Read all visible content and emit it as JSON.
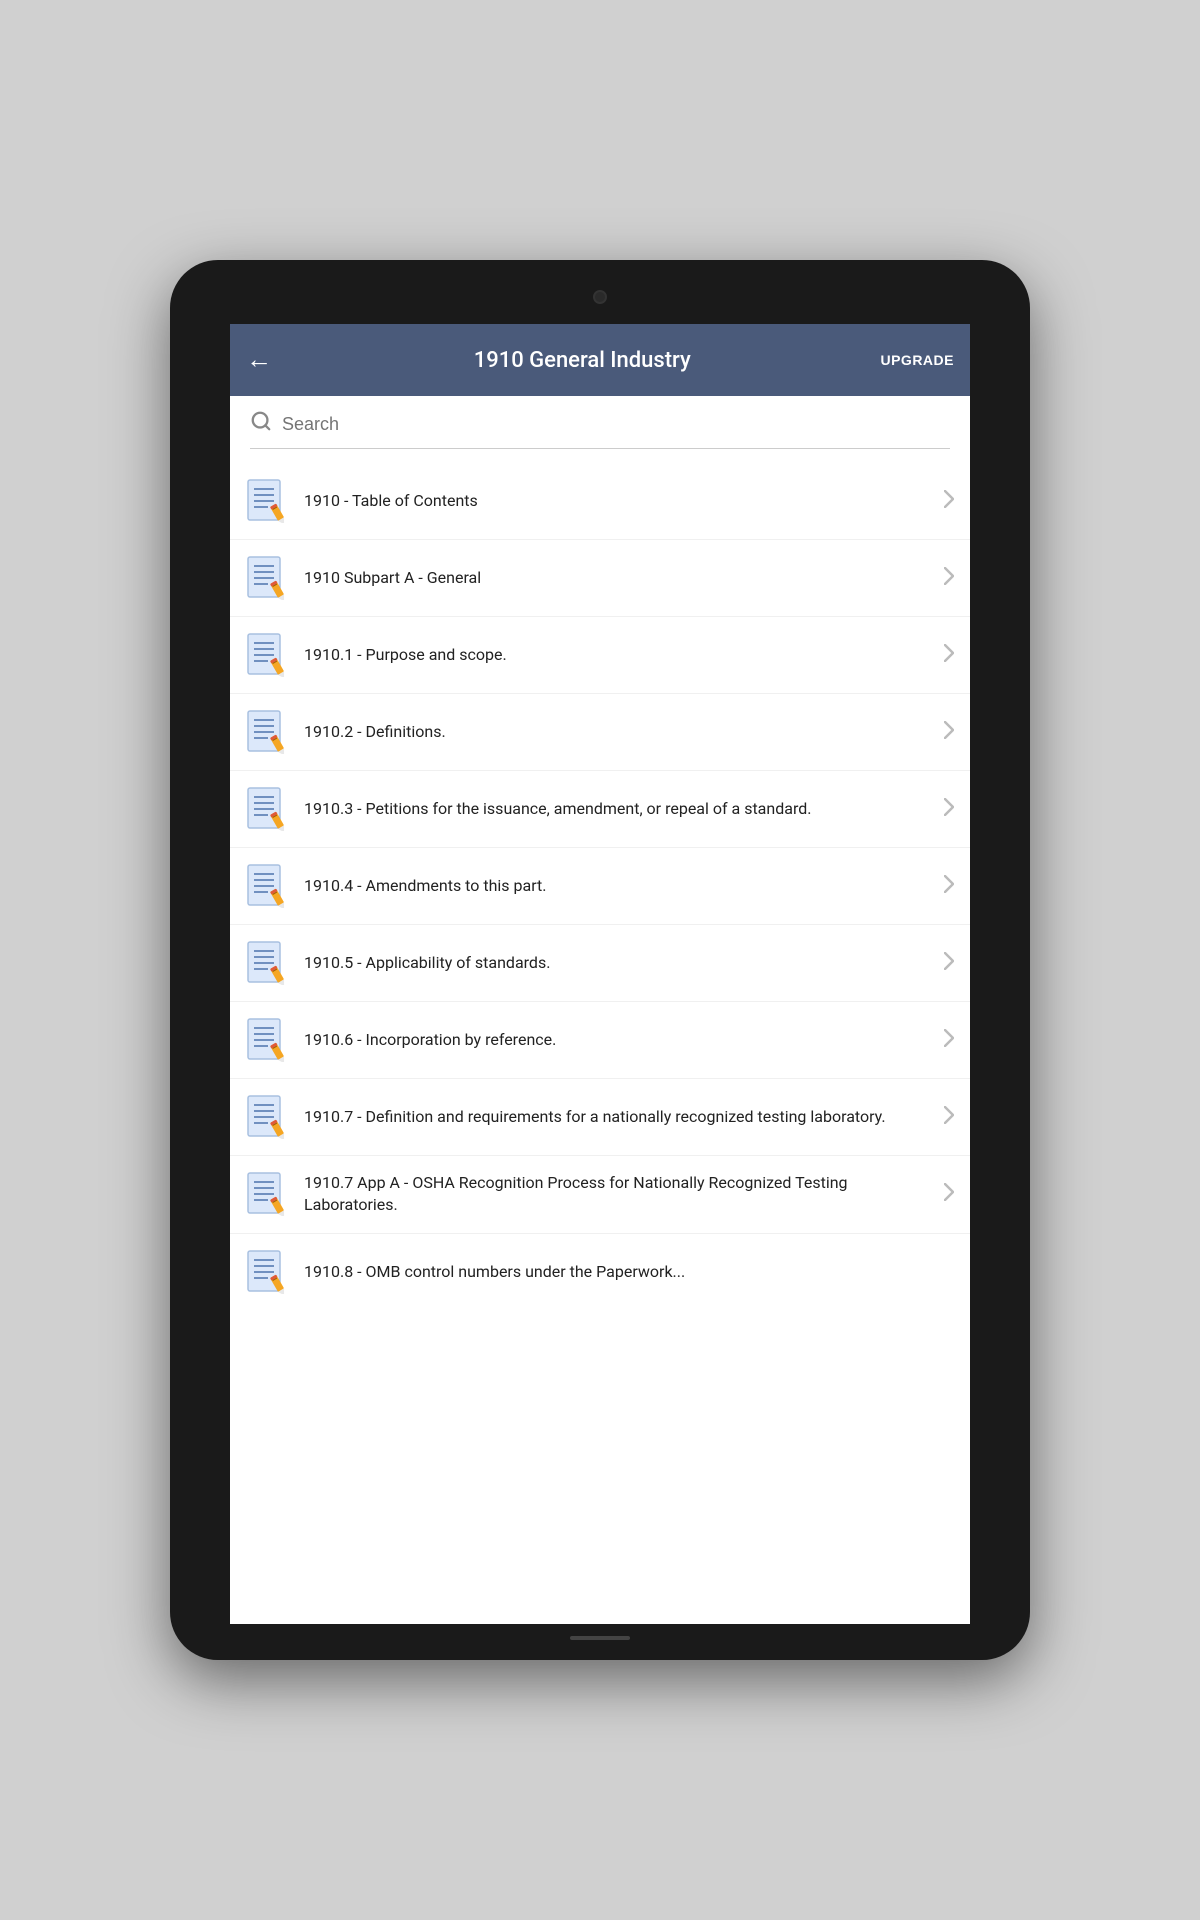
{
  "header": {
    "title": "1910 General Industry",
    "back_label": "←",
    "upgrade_label": "UPGRADE"
  },
  "search": {
    "placeholder": "Search"
  },
  "items": [
    {
      "id": 1,
      "label": "1910 - Table of Contents"
    },
    {
      "id": 2,
      "label": "1910 Subpart A - General"
    },
    {
      "id": 3,
      "label": "1910.1 - Purpose and scope."
    },
    {
      "id": 4,
      "label": "1910.2 - Definitions."
    },
    {
      "id": 5,
      "label": "1910.3 - Petitions for the issuance, amendment, or repeal of a standard."
    },
    {
      "id": 6,
      "label": "1910.4 - Amendments to this part."
    },
    {
      "id": 7,
      "label": "1910.5 - Applicability of standards."
    },
    {
      "id": 8,
      "label": "1910.6 - Incorporation by reference."
    },
    {
      "id": 9,
      "label": "1910.7 - Definition and requirements for a nationally recognized testing laboratory."
    },
    {
      "id": 10,
      "label": "1910.7 App A - OSHA Recognition Process for Nationally Recognized Testing Laboratories."
    },
    {
      "id": 11,
      "label": "1910.8 - OMB control numbers under the Paperwork..."
    }
  ]
}
